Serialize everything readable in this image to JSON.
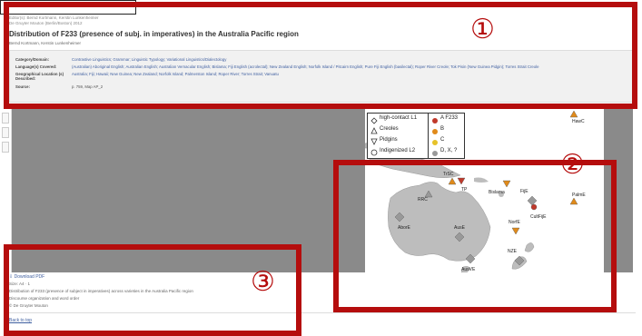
{
  "header": {
    "publisher_lines": [
      "Editor(s): Bernd Kortmann, Kerstin Lunkenheimer",
      "De Gruyter Mouton (Berlin/Boston) 2012"
    ],
    "title": "Distribution of F233 (presence of subj. in imperatives) in the Australia Pacific region",
    "authors": "Bernd Kortmann, Kerstin Lunkenheimer"
  },
  "metadata": [
    {
      "key": "Category/Domain:",
      "value": "Contrastive Linguistics; Grammar; Linguistic Typology; Variational Linguistics/Dialectology"
    },
    {
      "key": "Language(s) Covered:",
      "value": "(Australian) Aboriginal English; Australian English; Australian Vernacular English; Bislama; Fiji English (acrolectal); New Zealand English; Norfolk Island / Pitcairn English; Pure Fiji English (basilectal); Roper River Creole; Tok Pisin (New Guinea Pidgin); Torres Strait Creole"
    },
    {
      "key": "Geographical Location (s) Described:",
      "value": "Australia; Fiji; Hawaii; New Guinea; New Zealand; Norfolk Island; Palmerston Island; Roper River; Torres Strait; Vanuatu"
    },
    {
      "key": "Source:",
      "value": "p. 759, Map AP_2"
    }
  ],
  "legend": {
    "shapes": [
      "high-contact L1",
      "Creoles",
      "Pidgins",
      "Indigenized L2"
    ],
    "values": [
      "A F233",
      "B",
      "C",
      "D, X, ?"
    ],
    "colors": [
      "#c0392b",
      "#e08a1a",
      "#e6c229",
      "#999999"
    ]
  },
  "map_labels": {
    "hawc": "HawC",
    "trsc": "TrSC",
    "tp": "TP",
    "rrc": "RRC",
    "bislama": "Bislama",
    "fije": "FijE",
    "palme": "PalmE",
    "cultfije": "CultFijE",
    "norfk": "NorfE",
    "abore": "AborE",
    "ause": "AusE",
    "nze": "NZE",
    "ausve": "AusVE"
  },
  "footer": {
    "download": "⇩ Download PDF",
    "size": "Size: A4 · 1",
    "description": "Distribution of F233 (presence of subject in imperatives) across varieties in the Australia Pacific region",
    "topics": "Discourse organization and word order",
    "publisher": "© De Gruyter Mouton",
    "back_link": "Back to top"
  },
  "annotations": {
    "one": "①",
    "two": "②",
    "three": "③"
  },
  "colors": {
    "annotation_red": "#b50d0d",
    "band_grey": "#8a8a8a",
    "link_blue": "#3f5fa0"
  }
}
